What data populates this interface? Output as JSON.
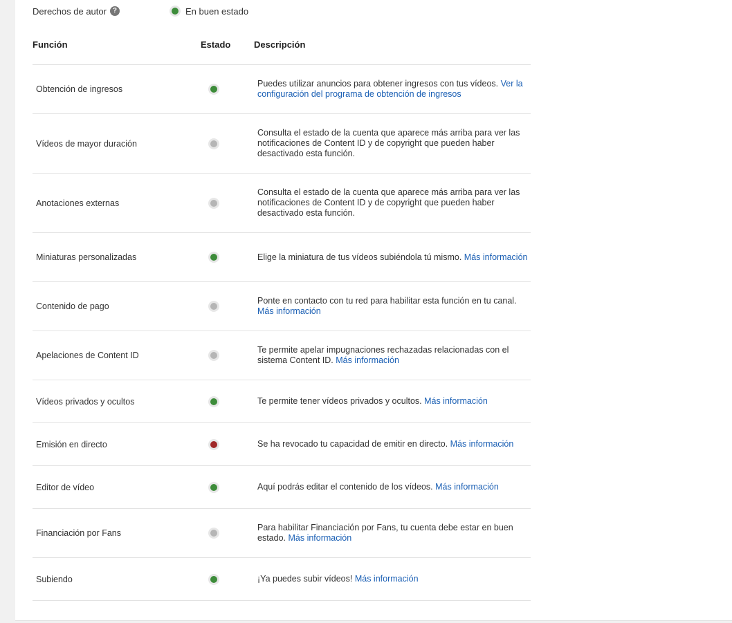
{
  "copyright": {
    "label": "Derechos de autor",
    "help_icon": "?",
    "status_text": "En buen estado",
    "status_color": "green"
  },
  "table": {
    "headers": {
      "function": "Función",
      "state": "Estado",
      "description": "Descripción"
    },
    "rows": [
      {
        "name": "Obtención de ingresos",
        "status": "green",
        "desc": "Puedes utilizar anuncios para obtener ingresos con tus vídeos. ",
        "link": "Ver la configuración del programa de obtención de ingresos"
      },
      {
        "name": "Vídeos de mayor duración",
        "status": "grey",
        "desc": "Consulta el estado de la cuenta que aparece más arriba para ver las notificaciones de Content ID y de copyright que pueden haber desactivado esta función.",
        "link": ""
      },
      {
        "name": "Anotaciones externas",
        "status": "grey",
        "desc": "Consulta el estado de la cuenta que aparece más arriba para ver las notificaciones de Content ID y de copyright que pueden haber desactivado esta función.",
        "link": ""
      },
      {
        "name": "Miniaturas personalizadas",
        "status": "green",
        "desc": "Elige la miniatura de tus vídeos subiéndola tú mismo. ",
        "link": "Más información"
      },
      {
        "name": "Contenido de pago",
        "status": "grey",
        "desc": "Ponte en contacto con tu red para habilitar esta función en tu canal. ",
        "link": "Más información"
      },
      {
        "name": "Apelaciones de Content ID",
        "status": "grey",
        "desc": "Te permite apelar impugnaciones rechazadas relacionadas con el sistema Content ID. ",
        "link": "Más información"
      },
      {
        "name": "Vídeos privados y ocultos",
        "status": "green",
        "desc": "Te permite tener vídeos privados y ocultos. ",
        "link": "Más información"
      },
      {
        "name": "Emisión en directo",
        "status": "red",
        "desc": "Se ha revocado tu capacidad de emitir en directo. ",
        "link": "Más información"
      },
      {
        "name": "Editor de vídeo",
        "status": "green",
        "desc": "Aquí podrás editar el contenido de los vídeos. ",
        "link": "Más información"
      },
      {
        "name": "Financiación por Fans",
        "status": "grey",
        "desc": "Para habilitar Financiación por Fans, tu cuenta debe estar en buen estado. ",
        "link": "Más información"
      },
      {
        "name": "Subiendo",
        "status": "green",
        "desc": "¡Ya puedes subir vídeos! ",
        "link": "Más información"
      }
    ]
  },
  "colors": {
    "green": "#3d8c3a",
    "grey": "#b5b5b5",
    "red": "#a02828",
    "link": "#1a5fb4"
  }
}
